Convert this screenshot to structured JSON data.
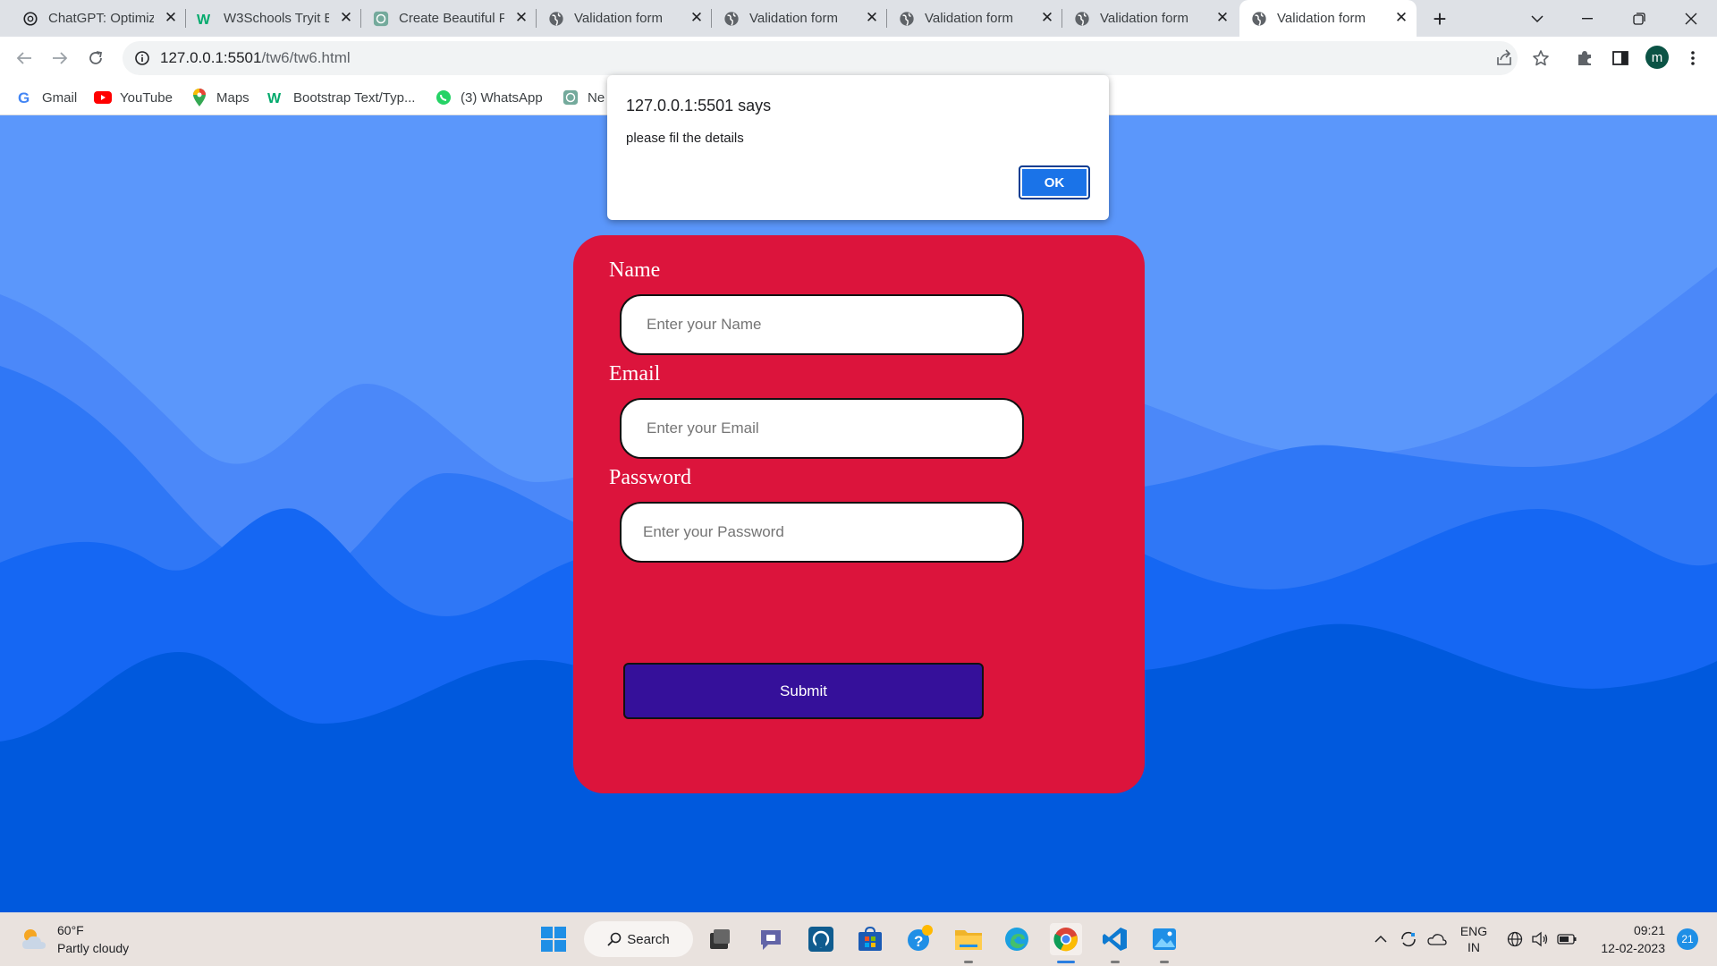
{
  "browser": {
    "tabs": [
      {
        "title": "ChatGPT: Optimiz",
        "favicon": "openai-icon"
      },
      {
        "title": "W3Schools Tryit E",
        "favicon": "w3schools-icon"
      },
      {
        "title": "Create Beautiful F",
        "favicon": "openai-icon"
      },
      {
        "title": "Validation form",
        "favicon": "globe-icon"
      },
      {
        "title": "Validation form",
        "favicon": "globe-icon"
      },
      {
        "title": "Validation form",
        "favicon": "globe-icon"
      },
      {
        "title": "Validation form",
        "favicon": "globe-icon"
      },
      {
        "title": "Validation form",
        "favicon": "globe-icon",
        "active": true
      }
    ],
    "url_host": "127.0.0.1:5501",
    "url_path": "/tw6/tw6.html",
    "profile_initial": "m",
    "bookmarks": [
      {
        "label": "Gmail",
        "icon": "google-icon"
      },
      {
        "label": "YouTube",
        "icon": "youtube-icon"
      },
      {
        "label": "Maps",
        "icon": "maps-icon"
      },
      {
        "label": "Bootstrap Text/Typ...",
        "icon": "w3schools-icon"
      },
      {
        "label": "(3) WhatsApp",
        "icon": "whatsapp-icon"
      },
      {
        "label": "Ne",
        "icon": "openai-icon"
      }
    ]
  },
  "dialog": {
    "title": "127.0.0.1:5501 says",
    "message": "please fil the details",
    "ok_label": "OK"
  },
  "form": {
    "name_label": "Name",
    "name_placeholder": "Enter your Name",
    "email_label": "Email",
    "email_placeholder": "Enter your Email",
    "password_label": "Password",
    "password_placeholder": "Enter your Password",
    "submit_label": "Submit"
  },
  "taskbar": {
    "weather_temp": "60°F",
    "weather_desc": "Partly cloudy",
    "search_label": "Search",
    "lang_1": "ENG",
    "lang_2": "IN",
    "time": "09:21",
    "date": "12-02-2023",
    "notification_count": "21"
  },
  "colors": {
    "card": "#dc143c",
    "submit": "#35109a",
    "wave_light": "#5b97fb",
    "wave_dark": "#0059dd",
    "ok_button": "#1a73e8"
  }
}
